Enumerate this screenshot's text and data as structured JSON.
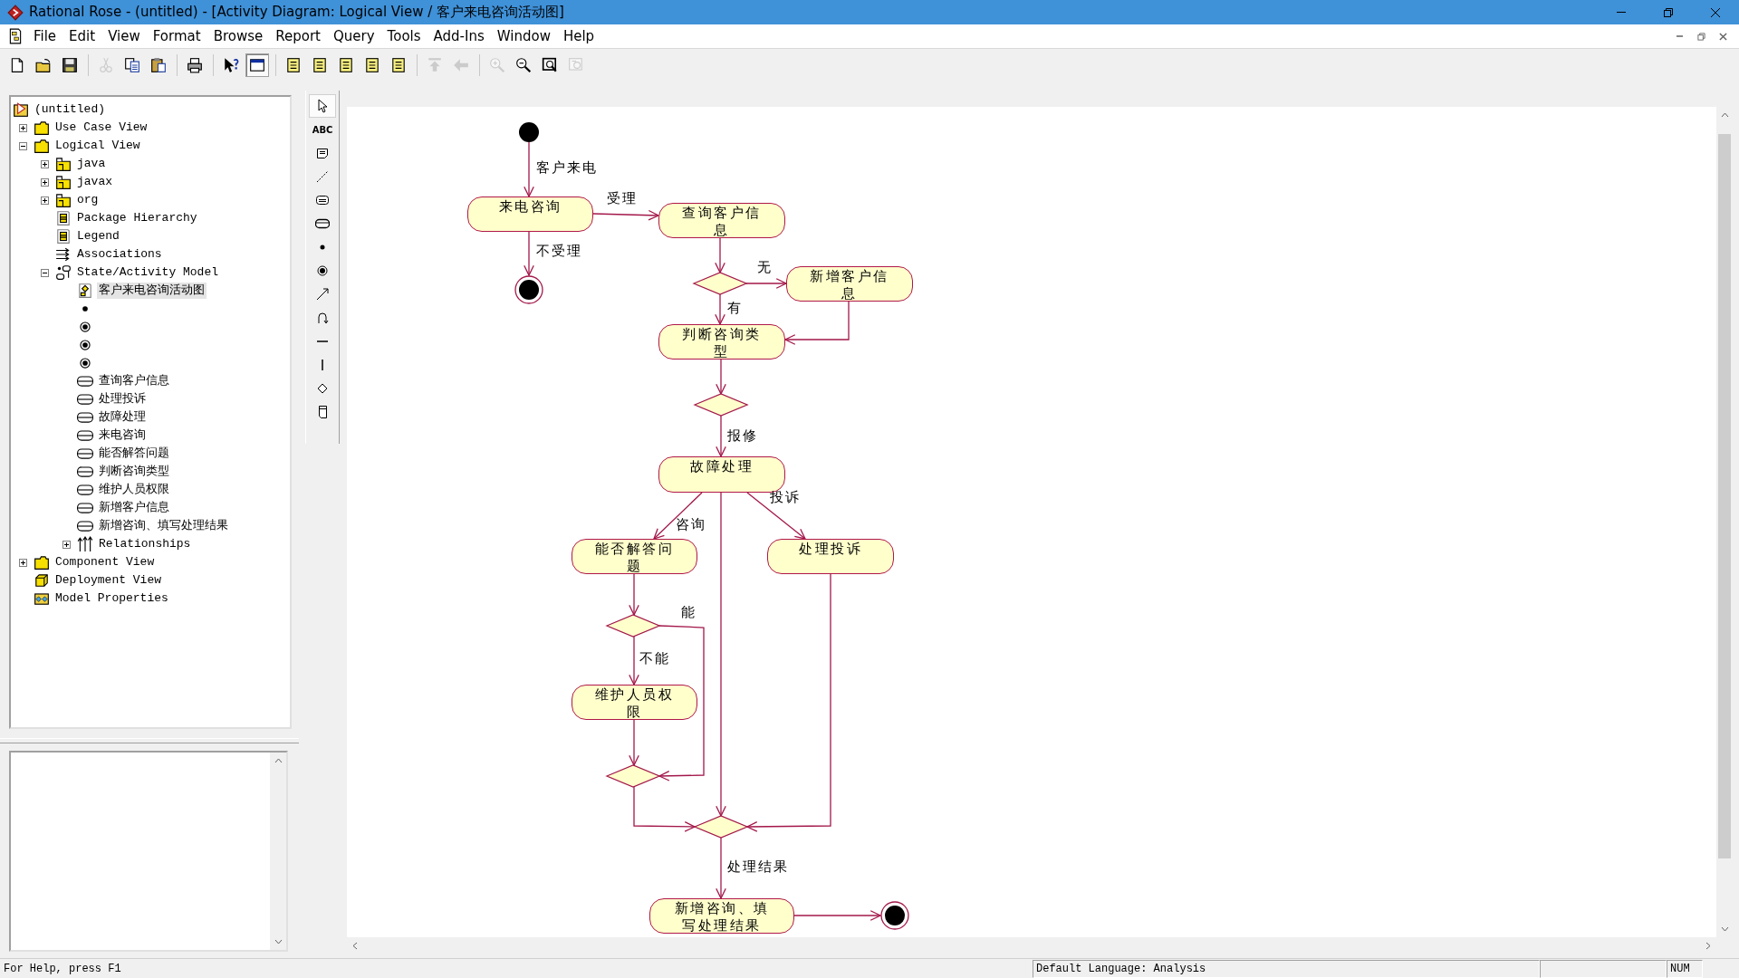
{
  "window": {
    "title": "Rational Rose - (untitled) - [Activity Diagram: Logical View / 客户来电咨询活动图]"
  },
  "menu": [
    "File",
    "Edit",
    "View",
    "Format",
    "Browse",
    "Report",
    "Query",
    "Tools",
    "Add-Ins",
    "Window",
    "Help"
  ],
  "toolbar": [
    {
      "kind": "new",
      "disabled": false,
      "pressed": false
    },
    {
      "kind": "open",
      "disabled": false,
      "pressed": false
    },
    {
      "kind": "save",
      "disabled": false,
      "pressed": false
    },
    {
      "kind": "separator"
    },
    {
      "kind": "cut",
      "disabled": true,
      "pressed": false
    },
    {
      "kind": "copy",
      "disabled": false,
      "pressed": false
    },
    {
      "kind": "paste",
      "disabled": false,
      "pressed": false
    },
    {
      "kind": "separator"
    },
    {
      "kind": "print",
      "disabled": false,
      "pressed": false
    },
    {
      "kind": "separator"
    },
    {
      "kind": "help",
      "disabled": false,
      "pressed": false
    },
    {
      "kind": "window",
      "disabled": false,
      "pressed": true
    },
    {
      "kind": "separator"
    },
    {
      "kind": "browse",
      "disabled": false,
      "pressed": false
    },
    {
      "kind": "browse",
      "disabled": false,
      "pressed": false
    },
    {
      "kind": "browse",
      "disabled": false,
      "pressed": false
    },
    {
      "kind": "browse",
      "disabled": false,
      "pressed": false
    },
    {
      "kind": "browse",
      "disabled": false,
      "pressed": false
    },
    {
      "kind": "separator"
    },
    {
      "kind": "up",
      "disabled": true,
      "pressed": false
    },
    {
      "kind": "back",
      "disabled": true,
      "pressed": false
    },
    {
      "kind": "separator"
    },
    {
      "kind": "zoom-in",
      "disabled": true,
      "pressed": false
    },
    {
      "kind": "zoom-out",
      "disabled": false,
      "pressed": false
    },
    {
      "kind": "fit",
      "disabled": false,
      "pressed": false
    },
    {
      "kind": "undo-fit",
      "disabled": true,
      "pressed": false
    }
  ],
  "browser_tree": [
    {
      "kind": "model",
      "label": "(untitled)",
      "selected": false,
      "children": [
        {
          "kind": "folder",
          "label": "Use Case View",
          "expanded": false,
          "selected": false
        },
        {
          "kind": "folder",
          "label": "Logical View",
          "expanded": true,
          "selected": false,
          "children": [
            {
              "kind": "package",
              "label": "java",
              "expanded": false,
              "selected": false
            },
            {
              "kind": "package",
              "label": "javax",
              "expanded": false,
              "selected": false
            },
            {
              "kind": "package",
              "label": "org",
              "expanded": false,
              "selected": false
            },
            {
              "kind": "diagram",
              "label": "Package Hierarchy",
              "selected": false
            },
            {
              "kind": "diagram",
              "label": "Legend",
              "selected": false
            },
            {
              "kind": "associations",
              "label": "Associations",
              "selected": false
            },
            {
              "kind": "state-model",
              "label": "State/Activity Model",
              "expanded": true,
              "selected": false,
              "children": [
                {
                  "kind": "activity-diagram",
                  "label": "客户来电咨询活动图",
                  "selected": true
                },
                {
                  "kind": "start",
                  "selected": false
                },
                {
                  "kind": "end",
                  "selected": false
                },
                {
                  "kind": "end",
                  "selected": false
                },
                {
                  "kind": "end",
                  "selected": false
                },
                {
                  "kind": "activity",
                  "label": "查询客户信息",
                  "selected": false
                },
                {
                  "kind": "activity",
                  "label": "处理投诉",
                  "selected": false
                },
                {
                  "kind": "activity",
                  "label": "故障处理",
                  "selected": false
                },
                {
                  "kind": "activity",
                  "label": "来电咨询",
                  "selected": false
                },
                {
                  "kind": "activity",
                  "label": "能否解答问题",
                  "selected": false
                },
                {
                  "kind": "activity",
                  "label": "判断咨询类型",
                  "selected": false
                },
                {
                  "kind": "activity",
                  "label": "维护人员权限",
                  "selected": false
                },
                {
                  "kind": "activity",
                  "label": "新增客户信息",
                  "selected": false
                },
                {
                  "kind": "activity",
                  "label": "新增咨询、填写处理结果",
                  "selected": false
                },
                {
                  "kind": "relationships",
                  "label": "Relationships",
                  "expanded": false,
                  "selected": false
                }
              ]
            }
          ]
        },
        {
          "kind": "folder",
          "label": "Component View",
          "expanded": false,
          "selected": false
        },
        {
          "kind": "deployment",
          "label": "Deployment View",
          "selected": false
        },
        {
          "kind": "properties",
          "label": "Model Properties",
          "selected": false
        }
      ]
    }
  ],
  "palette": [
    {
      "kind": "select",
      "selected": true
    },
    {
      "kind": "text",
      "label": "ABC",
      "selected": false
    },
    {
      "kind": "note",
      "selected": false
    },
    {
      "kind": "anchor",
      "selected": false
    },
    {
      "kind": "state",
      "selected": false
    },
    {
      "kind": "activity",
      "selected": false
    },
    {
      "kind": "start",
      "selected": false
    },
    {
      "kind": "end",
      "selected": false
    },
    {
      "kind": "transition",
      "selected": false
    },
    {
      "kind": "self-transition",
      "selected": false
    },
    {
      "kind": "hsync",
      "selected": false
    },
    {
      "kind": "vsync",
      "selected": false
    },
    {
      "kind": "decision",
      "selected": false
    },
    {
      "kind": "swimlane",
      "selected": false
    }
  ],
  "diagram": {
    "nodes": [
      {
        "kind": "start"
      },
      {
        "kind": "activity",
        "label": "来电咨询"
      },
      {
        "kind": "end"
      },
      {
        "kind": "activity",
        "label": "查询客户信息"
      },
      {
        "kind": "decision"
      },
      {
        "kind": "activity",
        "label": "新增客户信息"
      },
      {
        "kind": "activity",
        "label": "判断咨询类型"
      },
      {
        "kind": "decision"
      },
      {
        "kind": "activity",
        "label": "故障处理"
      },
      {
        "kind": "activity",
        "label": "能否解答问题"
      },
      {
        "kind": "activity",
        "label": "处理投诉"
      },
      {
        "kind": "decision"
      },
      {
        "kind": "activity",
        "label": "维护人员权限"
      },
      {
        "kind": "decision"
      },
      {
        "kind": "decision"
      },
      {
        "kind": "activity",
        "label": "新增咨询、填写处理结果"
      },
      {
        "kind": "end"
      }
    ],
    "transitions": [
      {
        "label": "客户来电"
      },
      {
        "label": "受理"
      },
      {
        "label": "不受理"
      },
      {
        "label": "无"
      },
      {
        "label": "有"
      },
      {
        "label": "报修"
      },
      {
        "label": "咨询"
      },
      {
        "label": "投诉"
      },
      {
        "label": "能"
      },
      {
        "label": "不能"
      },
      {
        "label": "处理结果"
      }
    ]
  },
  "status_bar": {
    "help": "For Help, press F1",
    "language": "Default Language: Analysis",
    "num": "NUM"
  }
}
